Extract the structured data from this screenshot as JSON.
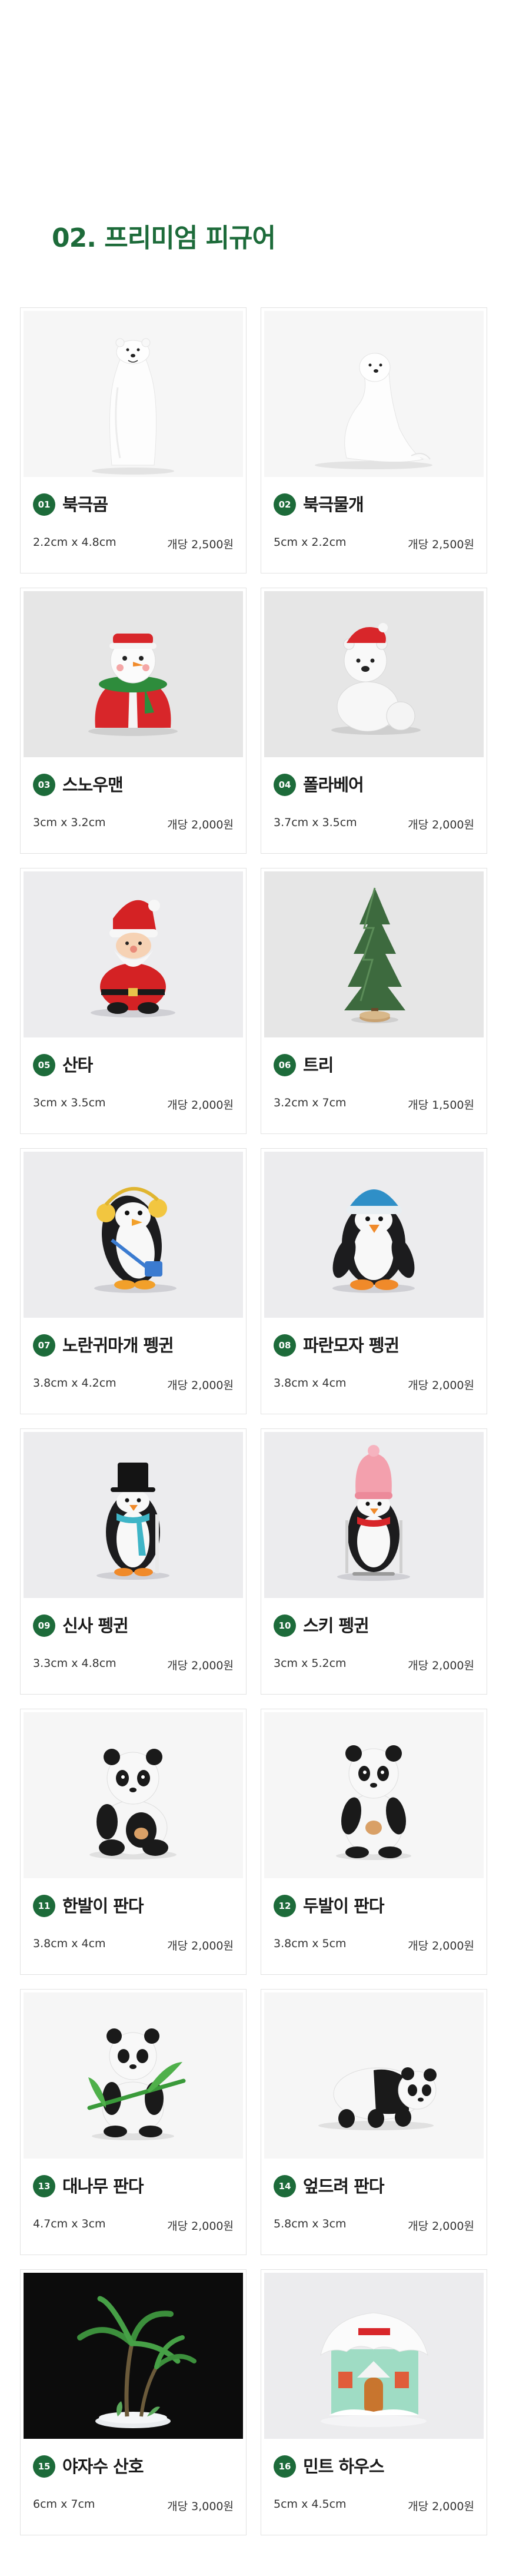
{
  "section": {
    "title": "02. 프리미엄 피규어"
  },
  "colors": {
    "accent": "#1d6b3a"
  },
  "products": [
    {
      "num": "01",
      "name": "북극곰",
      "size": "2.2cm x 4.8cm",
      "price": "개당 2,500원",
      "image": "polar-bear"
    },
    {
      "num": "02",
      "name": "북극물개",
      "size": "5cm x 2.2cm",
      "price": "개당 2,500원",
      "image": "seal"
    },
    {
      "num": "03",
      "name": "스노우맨",
      "size": "3cm x 3.2cm",
      "price": "개당 2,000원",
      "image": "snowman"
    },
    {
      "num": "04",
      "name": "폴라베어",
      "size": "3.7cm x 3.5cm",
      "price": "개당 2,000원",
      "image": "polar-bear-hat"
    },
    {
      "num": "05",
      "name": "산타",
      "size": "3cm x 3.5cm",
      "price": "개당 2,000원",
      "image": "santa"
    },
    {
      "num": "06",
      "name": "트리",
      "size": "3.2cm x 7cm",
      "price": "개당 1,500원",
      "image": "tree"
    },
    {
      "num": "07",
      "name": "노란귀마개 펭귄",
      "size": "3.8cm x 4.2cm",
      "price": "개당 2,000원",
      "image": "penguin-earmuffs"
    },
    {
      "num": "08",
      "name": "파란모자 펭귄",
      "size": "3.8cm x 4cm",
      "price": "개당 2,000원",
      "image": "penguin-blue-hat"
    },
    {
      "num": "09",
      "name": "신사 펭귄",
      "size": "3.3cm x 4.8cm",
      "price": "개당 2,000원",
      "image": "penguin-gentleman"
    },
    {
      "num": "10",
      "name": "스키 펭귄",
      "size": "3cm x 5.2cm",
      "price": "개당 2,000원",
      "image": "penguin-ski"
    },
    {
      "num": "11",
      "name": "한발이 판다",
      "size": "3.8cm x 4cm",
      "price": "개당 2,000원",
      "image": "panda-one-paw"
    },
    {
      "num": "12",
      "name": "두발이 판다",
      "size": "3.8cm x 5cm",
      "price": "개당 2,000원",
      "image": "panda-two-paws"
    },
    {
      "num": "13",
      "name": "대나무 판다",
      "size": "4.7cm x 3cm",
      "price": "개당 2,000원",
      "image": "panda-bamboo"
    },
    {
      "num": "14",
      "name": "엎드려 판다",
      "size": "5.8cm x 3cm",
      "price": "개당 2,000원",
      "image": "panda-lying"
    },
    {
      "num": "15",
      "name": "야자수 산호",
      "size": "6cm x 7cm",
      "price": "개당 3,000원",
      "image": "palm-coral"
    },
    {
      "num": "16",
      "name": "민트 하우스",
      "size": "5cm x 4.5cm",
      "price": "개당 2,000원",
      "image": "mint-house"
    }
  ]
}
